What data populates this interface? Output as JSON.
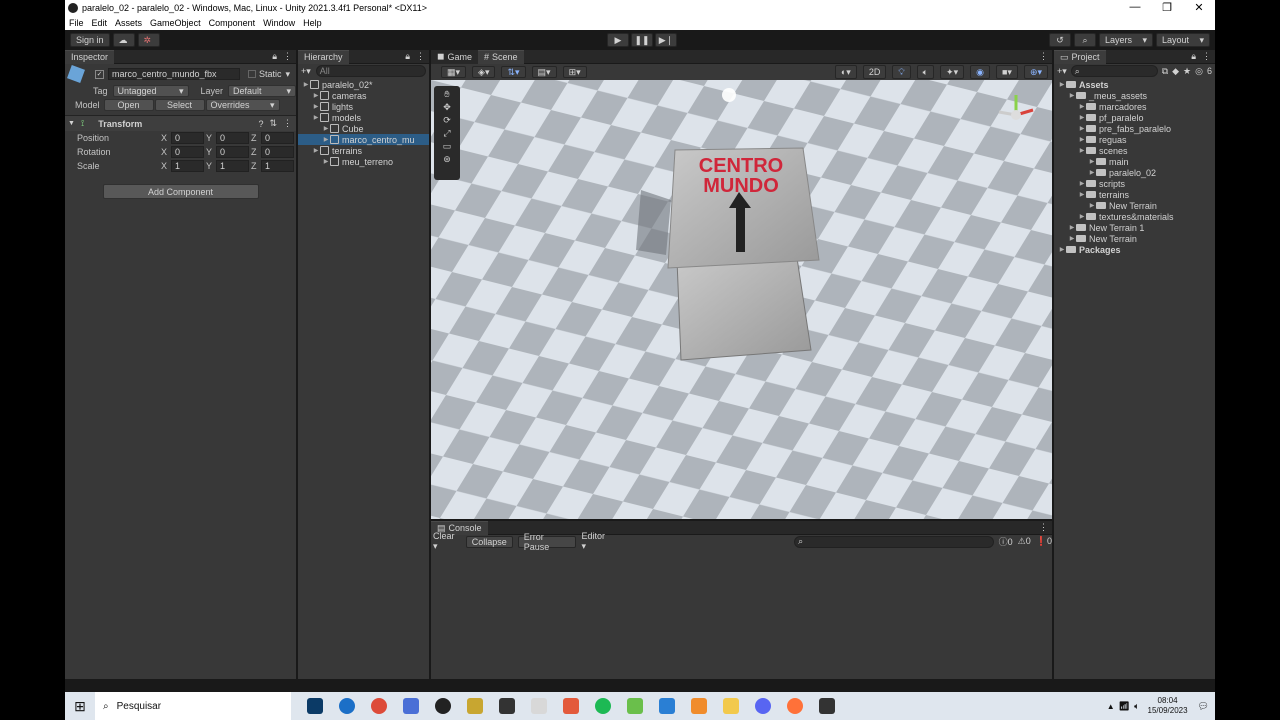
{
  "window": {
    "title": "paralelo_02 - paralelo_02 - Windows, Mac, Linux - Unity 2021.3.4f1 Personal* <DX11>",
    "controls": [
      "—",
      "❐",
      "✕"
    ]
  },
  "menu": [
    "File",
    "Edit",
    "Assets",
    "GameObject",
    "Component",
    "Window",
    "Help"
  ],
  "toolbar": {
    "sign_in": "Sign in",
    "layers": "Layers",
    "layout": "Layout"
  },
  "inspector": {
    "tab": "Inspector",
    "object_name": "marco_centro_mundo_fbx",
    "static": "Static",
    "tag_label": "Tag",
    "tag_value": "Untagged",
    "layer_label": "Layer",
    "layer_value": "Default",
    "model_label": "Model",
    "open": "Open",
    "select": "Select",
    "overrides": "Overrides",
    "transform": "Transform",
    "rows": [
      {
        "label": "Position",
        "x": "0",
        "y": "0",
        "z": "0"
      },
      {
        "label": "Rotation",
        "x": "0",
        "y": "0",
        "z": "0"
      },
      {
        "label": "Scale",
        "x": "1",
        "y": "1",
        "z": "1"
      }
    ],
    "axis": {
      "x": "X",
      "y": "Y",
      "z": "Z"
    },
    "add_component": "Add Component"
  },
  "hierarchy": {
    "tab": "Hierarchy",
    "search": "All",
    "items": [
      {
        "label": "paralelo_02*",
        "depth": 0
      },
      {
        "label": "cameras",
        "depth": 1
      },
      {
        "label": "lights",
        "depth": 1
      },
      {
        "label": "models",
        "depth": 1
      },
      {
        "label": "Cube",
        "depth": 2
      },
      {
        "label": "marco_centro_mu",
        "depth": 2
      },
      {
        "label": "terrains",
        "depth": 1
      },
      {
        "label": "meu_terreno",
        "depth": 2
      }
    ]
  },
  "scene": {
    "tab_game": "Game",
    "tab_scene": "Scene",
    "mode_2d": "2D",
    "sign_text_1": "CENTRO",
    "sign_text_2": "MUNDO"
  },
  "console": {
    "tab": "Console",
    "clear": "Clear",
    "collapse": "Collapse",
    "error_pause": "Error Pause",
    "editor": "Editor",
    "counts": [
      "0",
      "0",
      "0"
    ]
  },
  "project": {
    "tab": "Project",
    "badge": "6",
    "items": [
      {
        "label": "Assets",
        "depth": 0,
        "bold": true
      },
      {
        "label": "_meus_assets",
        "depth": 1
      },
      {
        "label": "marcadores",
        "depth": 2
      },
      {
        "label": "pf_paralelo",
        "depth": 2
      },
      {
        "label": "pre_fabs_paralelo",
        "depth": 2
      },
      {
        "label": "reguas",
        "depth": 2
      },
      {
        "label": "scenes",
        "depth": 2
      },
      {
        "label": "main",
        "depth": 3
      },
      {
        "label": "paralelo_02",
        "depth": 3
      },
      {
        "label": "scripts",
        "depth": 2
      },
      {
        "label": "terrains",
        "depth": 2
      },
      {
        "label": "New Terrain",
        "depth": 3
      },
      {
        "label": "textures&materials",
        "depth": 2
      },
      {
        "label": "New Terrain 1",
        "depth": 1
      },
      {
        "label": "New Terrain",
        "depth": 1
      },
      {
        "label": "Packages",
        "depth": 0,
        "bold": true
      }
    ]
  },
  "taskbar": {
    "search": "Pesquisar",
    "time": "08:04",
    "date": "15/09/2023"
  }
}
